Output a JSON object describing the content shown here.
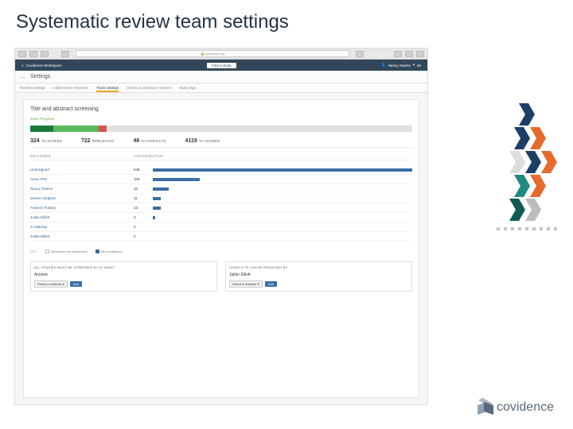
{
  "slide_title": "Systematic review team settings",
  "browser": {
    "url": "covidence.org"
  },
  "header": {
    "workspace": "Covidence Workspace",
    "center": "Find a study",
    "user": "Nancy Owens",
    "notifications": "69"
  },
  "settings": {
    "back_label": "←",
    "title": "Settings",
    "tabs": [
      "Review settings",
      "Add/remove reviewers",
      "Team settings",
      "Criteria & exclusion reasons",
      "Study tags"
    ],
    "active_tab": 2
  },
  "panel": {
    "title": "Title and abstract screening",
    "progress_label": "Team Progress",
    "progress": {
      "dark": 6,
      "green": 12,
      "red": 2,
      "gray": 80
    },
    "counts": [
      {
        "num": "324",
        "label": "TO SCREEN"
      },
      {
        "num": "722",
        "label": "IRRELEVANT"
      },
      {
        "num": "46",
        "label": "IN CONFLICTS"
      },
      {
        "num": "4119",
        "label": "TO SCREEN"
      }
    ],
    "table": {
      "head": [
        "REVIEWER",
        "CONTRIBUTION"
      ],
      "rows": [
        {
          "name": "Unassigned",
          "val": "945",
          "pct": 100
        },
        {
          "name": "Anna APD",
          "val": "100",
          "pct": 18
        },
        {
          "name": "Nancy Owens",
          "val": "33",
          "pct": 6
        },
        {
          "name": "James Hodgson",
          "val": "11",
          "pct": 3
        },
        {
          "name": "Frances Foskey",
          "val": "13",
          "pct": 3
        },
        {
          "name": "Julian Elliott",
          "val": "3",
          "pct": 1
        },
        {
          "name": "Jo Mackay",
          "val": "0",
          "pct": 0
        },
        {
          "name": "Julian Elliott",
          "val": "0",
          "pct": 0
        }
      ]
    },
    "legend": {
      "caption": "KEY:",
      "item1": "Reviewers not transferred",
      "item2": "My contribution"
    },
    "policies": {
      "left": {
        "title": "ALL STUDIES MUST BE SCREENED BY AT LEAST",
        "value": "Anyone",
        "select": "Select a reviewer",
        "add": "Add"
      },
      "right": {
        "title": "CONFLICTS CAN BE RESOLVED BY",
        "value": "Julian Elliott",
        "select": "Select a reviewer",
        "add": "Add"
      }
    }
  },
  "footer": {
    "brand": "covidence"
  }
}
